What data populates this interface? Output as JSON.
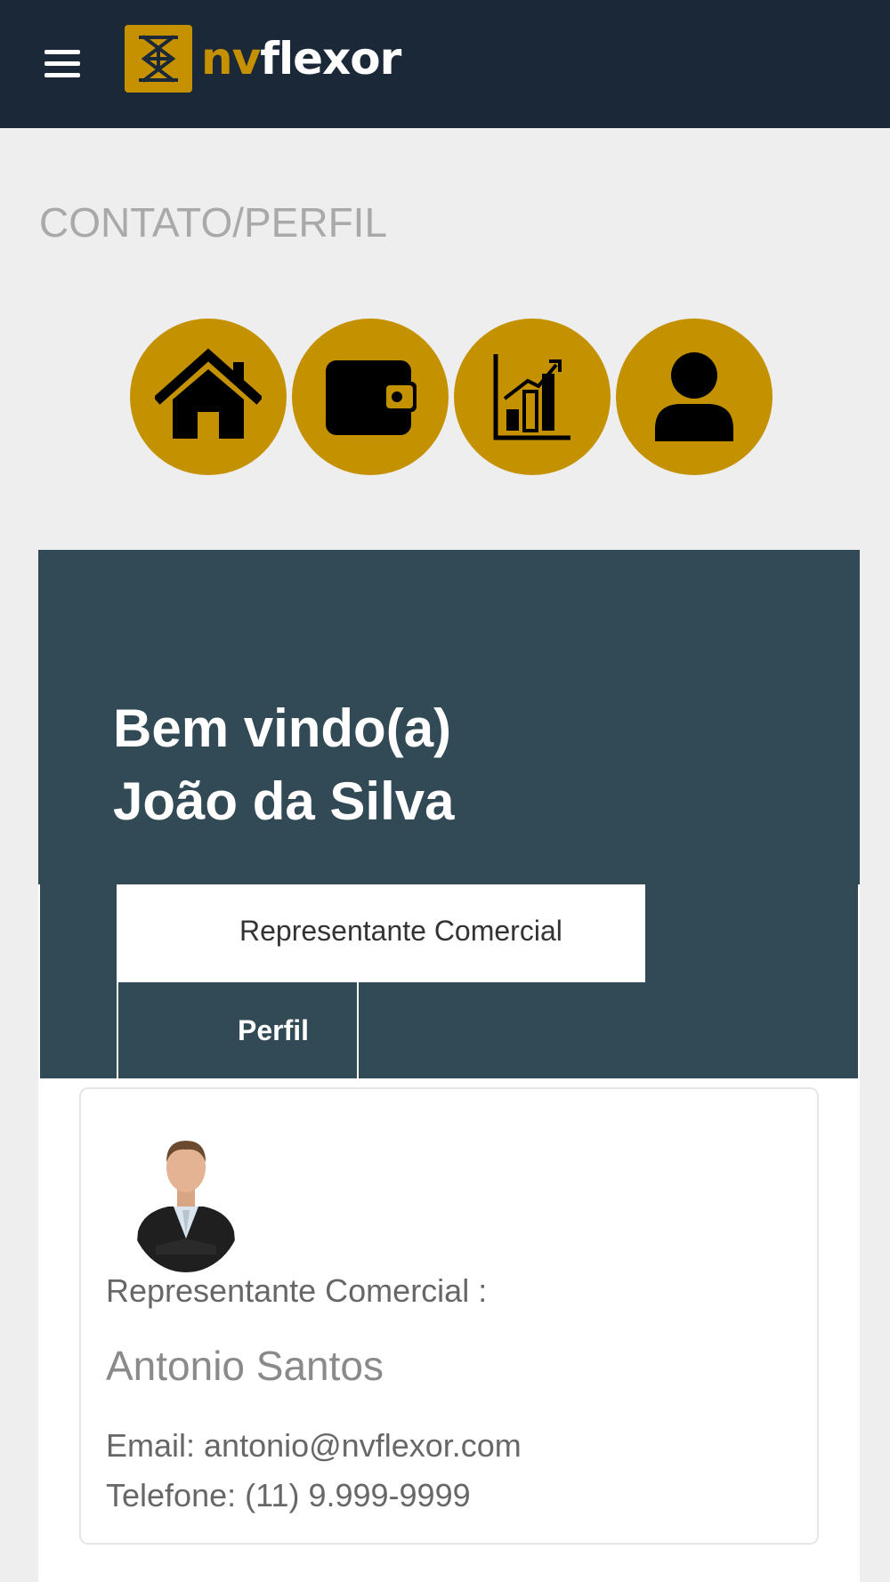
{
  "header": {
    "menu_icon": "hamburger-menu-icon",
    "logo_icon": "nvflexor-logo-icon",
    "logo_text_nv": "nv",
    "logo_text_flexor": "flexor"
  },
  "page": {
    "title": "CONTATO/PERFIL"
  },
  "nav": {
    "items": [
      {
        "icon": "home-icon"
      },
      {
        "icon": "wallet-icon"
      },
      {
        "icon": "chart-icon"
      },
      {
        "icon": "user-icon"
      }
    ],
    "color": "#c49100"
  },
  "welcome": {
    "line1": "Bem vindo(a)",
    "line2": "João da Silva"
  },
  "tabs": [
    {
      "label": "Representante Comercial",
      "active": true
    },
    {
      "label": "Perfil",
      "active": false
    }
  ],
  "representative": {
    "heading": "Representante Comercial :",
    "name": "Antonio Santos",
    "email": "Email: antonio@nvflexor.com",
    "phone": "Telefone: (11) 9.999-9999",
    "photo_icon": "representative-photo"
  },
  "colors": {
    "topbar": "#1b2838",
    "panel": "#324a56",
    "accent": "#c49100",
    "background": "#eeeeee"
  }
}
